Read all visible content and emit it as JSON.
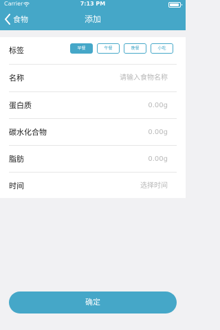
{
  "status_bar": {
    "carrier": "Carrier",
    "time": "7:13 PM"
  },
  "navbar": {
    "back_label": "食物",
    "title": "添加"
  },
  "form": {
    "tags": {
      "label": "标签",
      "options": [
        "早餐",
        "午餐",
        "晚餐",
        "小吃"
      ],
      "selected": "早餐"
    },
    "name": {
      "label": "名称",
      "placeholder": "请输入食物名称"
    },
    "protein": {
      "label": "蛋白质",
      "placeholder": "0.00g"
    },
    "carbs": {
      "label": "碳水化合物",
      "placeholder": "0.00g"
    },
    "fat": {
      "label": "脂肪",
      "placeholder": "0.00g"
    },
    "time": {
      "label": "时间",
      "placeholder": "选择时间"
    }
  },
  "confirm_label": "确定",
  "colors": {
    "accent": "#45a7c8",
    "background": "#f1f1f3",
    "placeholder": "#b8b8b8"
  }
}
